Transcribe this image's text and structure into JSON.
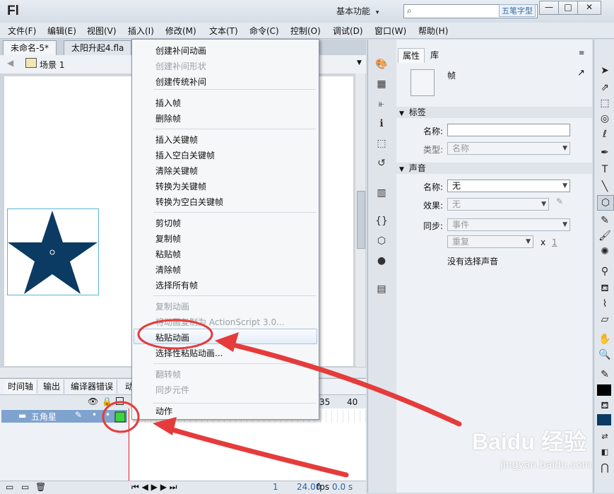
{
  "app": {
    "logo": "Fl",
    "workspace": "基本功能",
    "workspace_caret": "▾",
    "search_placeholder": "",
    "watermark_tag": "五笔字型",
    "window_buttons": [
      "—",
      "□",
      "✕"
    ]
  },
  "menubar": [
    "文件(F)",
    "编辑(E)",
    "视图(V)",
    "插入(I)",
    "修改(M)",
    "文本(T)",
    "命令(C)",
    "控制(O)",
    "调试(D)",
    "窗口(W)",
    "帮助(H)"
  ],
  "doc_tabs": [
    "未命名-5*",
    "太阳升起4.fla"
  ],
  "editbar": {
    "scene": "场景 1"
  },
  "timeline": {
    "tabs": [
      "时间轴",
      "输出",
      "编译器错误",
      "动"
    ],
    "frame_numbers": [
      "35",
      "40"
    ],
    "layer_name": "五角星",
    "footer": {
      "frame": "1",
      "fps": "24.00",
      "fps_unit": "fps",
      "time": "0.0 s"
    }
  },
  "properties": {
    "tabs": [
      "属性",
      "库"
    ],
    "object_type": "帧",
    "sections": {
      "label": {
        "title": "标签",
        "name_label": "名称:",
        "name_value": "",
        "type_label": "类型:",
        "type_value": "名称"
      },
      "sound": {
        "title": "声音",
        "name_label": "名称:",
        "name_value": "无",
        "effect_label": "效果:",
        "effect_value": "无",
        "sync_label": "同步:",
        "sync_value": "事件",
        "repeat_value": "重复",
        "repeat_x": "x",
        "repeat_count": "1",
        "status": "没有选择声音"
      }
    }
  },
  "context_menu": {
    "items": [
      {
        "label": "创建补间动画",
        "enabled": true
      },
      {
        "label": "创建补间形状",
        "enabled": false
      },
      {
        "label": "创建传统补间",
        "enabled": true
      },
      {
        "label": "插入帧",
        "enabled": true
      },
      {
        "label": "删除帧",
        "enabled": true
      },
      {
        "label": "插入关键帧",
        "enabled": true
      },
      {
        "label": "插入空白关键帧",
        "enabled": true
      },
      {
        "label": "清除关键帧",
        "enabled": true
      },
      {
        "label": "转换为关键帧",
        "enabled": true
      },
      {
        "label": "转换为空白关键帧",
        "enabled": true
      },
      {
        "label": "剪切帧",
        "enabled": true
      },
      {
        "label": "复制帧",
        "enabled": true
      },
      {
        "label": "粘贴帧",
        "enabled": true
      },
      {
        "label": "清除帧",
        "enabled": true
      },
      {
        "label": "选择所有帧",
        "enabled": true
      },
      {
        "label": "复制动画",
        "enabled": false
      },
      {
        "label": "将动画复制为 ActionScript 3.0...",
        "enabled": false
      },
      {
        "label": "粘贴动画",
        "enabled": true,
        "highlighted": true
      },
      {
        "label": "选择性粘贴动画...",
        "enabled": true
      },
      {
        "label": "翻转帧",
        "enabled": false
      },
      {
        "label": "同步元件",
        "enabled": false
      },
      {
        "label": "动作",
        "enabled": true
      }
    ]
  },
  "watermark": {
    "brand": "Baidu 经验",
    "url": "jingyan.baidu.com"
  },
  "colors": {
    "star": "#0b3a63",
    "annotation": "#e63b3b",
    "keyframe": "#3fd43f",
    "layer_row": "#7fa3cf"
  }
}
